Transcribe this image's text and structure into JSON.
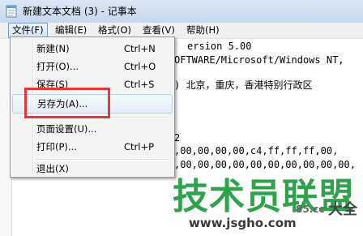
{
  "window": {
    "title": "新建文本文档 (3) - 记事本"
  },
  "menubar": {
    "items": [
      "文件(F)",
      "编辑(E)",
      "格式(O)",
      "查看(V)",
      "帮助(H)"
    ]
  },
  "file_menu": {
    "items": [
      {
        "label": "新建(N)",
        "shortcut": "Ctrl+N"
      },
      {
        "label": "打开(O)...",
        "shortcut": "Ctrl+O"
      },
      {
        "label": "保存(S)",
        "shortcut": "Ctrl+S"
      },
      {
        "label": "另存为(A)...",
        "shortcut": ""
      },
      {
        "label": "页面设置(U)...",
        "shortcut": ""
      },
      {
        "label": "打印(P)...",
        "shortcut": "Ctrl+P"
      },
      {
        "label": "退出(X)",
        "shortcut": ""
      }
    ]
  },
  "editor": {
    "lines": [
      "ersion 5.00",
      "OFTWARE/Microsoft/Windows NT,",
      ") 北京，重庆，香港特别行政区",
      "2",
      ",00,00,00,00,c4,ff,ff,ff,00,",
      ",00,00,00,00,00,00,00,00,00,00,"
    ]
  },
  "watermark": {
    "main": "技术员联盟",
    "url": "www.jsgho.com",
    "sub": "85.cc",
    "side": "大全"
  },
  "colors": {
    "highlight": "#e53935",
    "watermark_green": "#2ea34b"
  }
}
